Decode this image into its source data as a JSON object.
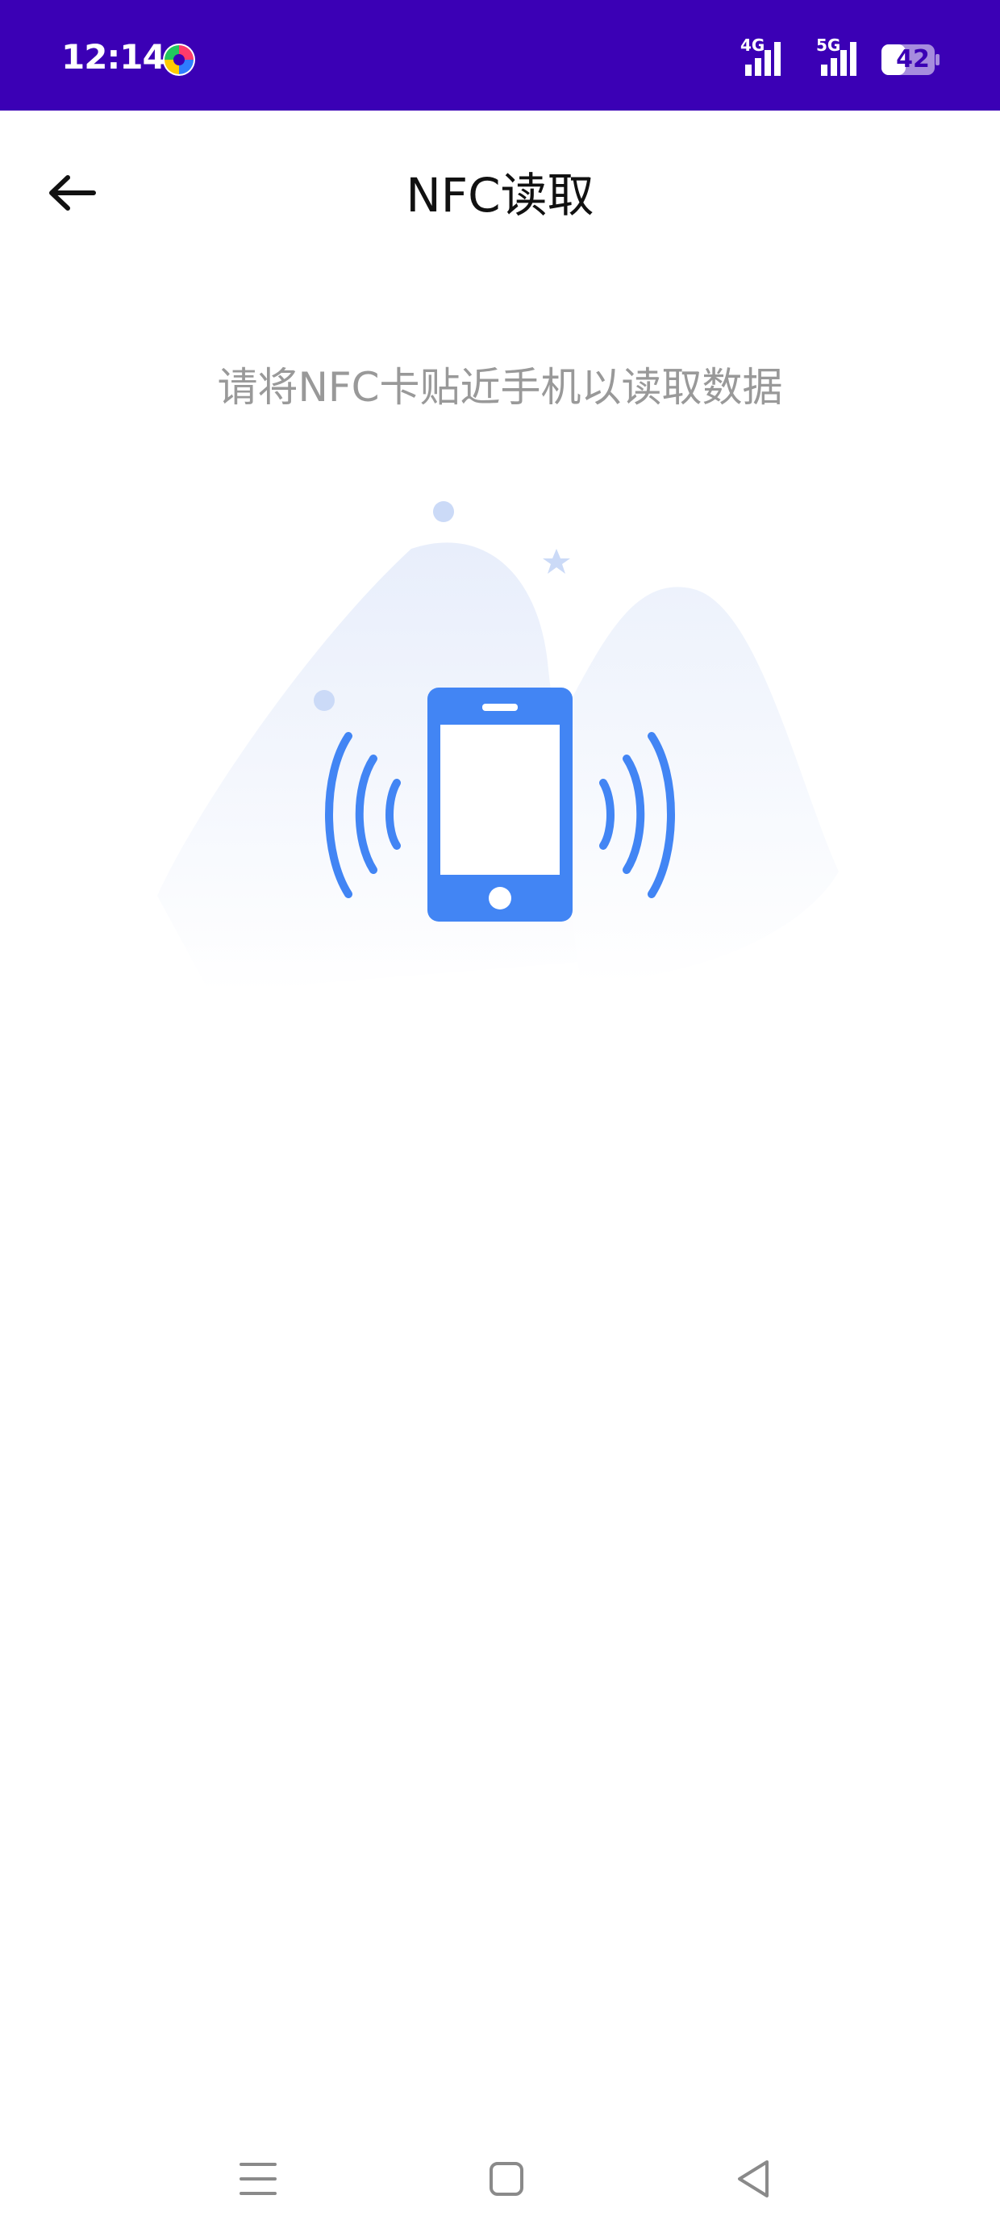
{
  "status_bar": {
    "time": "12:14",
    "network_1": "4G",
    "network_2": "5G",
    "battery": "42",
    "background_color": "#3b00b5"
  },
  "app_bar": {
    "title": "NFC读取",
    "back_icon": "arrow-left-icon"
  },
  "main": {
    "instruction": "请将NFC卡贴近手机以读取数据",
    "illustration_icon": "phone-nfc-icon",
    "accent_color": "#4285f4"
  },
  "nav_bar": {
    "menu_icon": "menu-icon",
    "home_icon": "home-square-icon",
    "back_icon": "back-triangle-icon"
  }
}
